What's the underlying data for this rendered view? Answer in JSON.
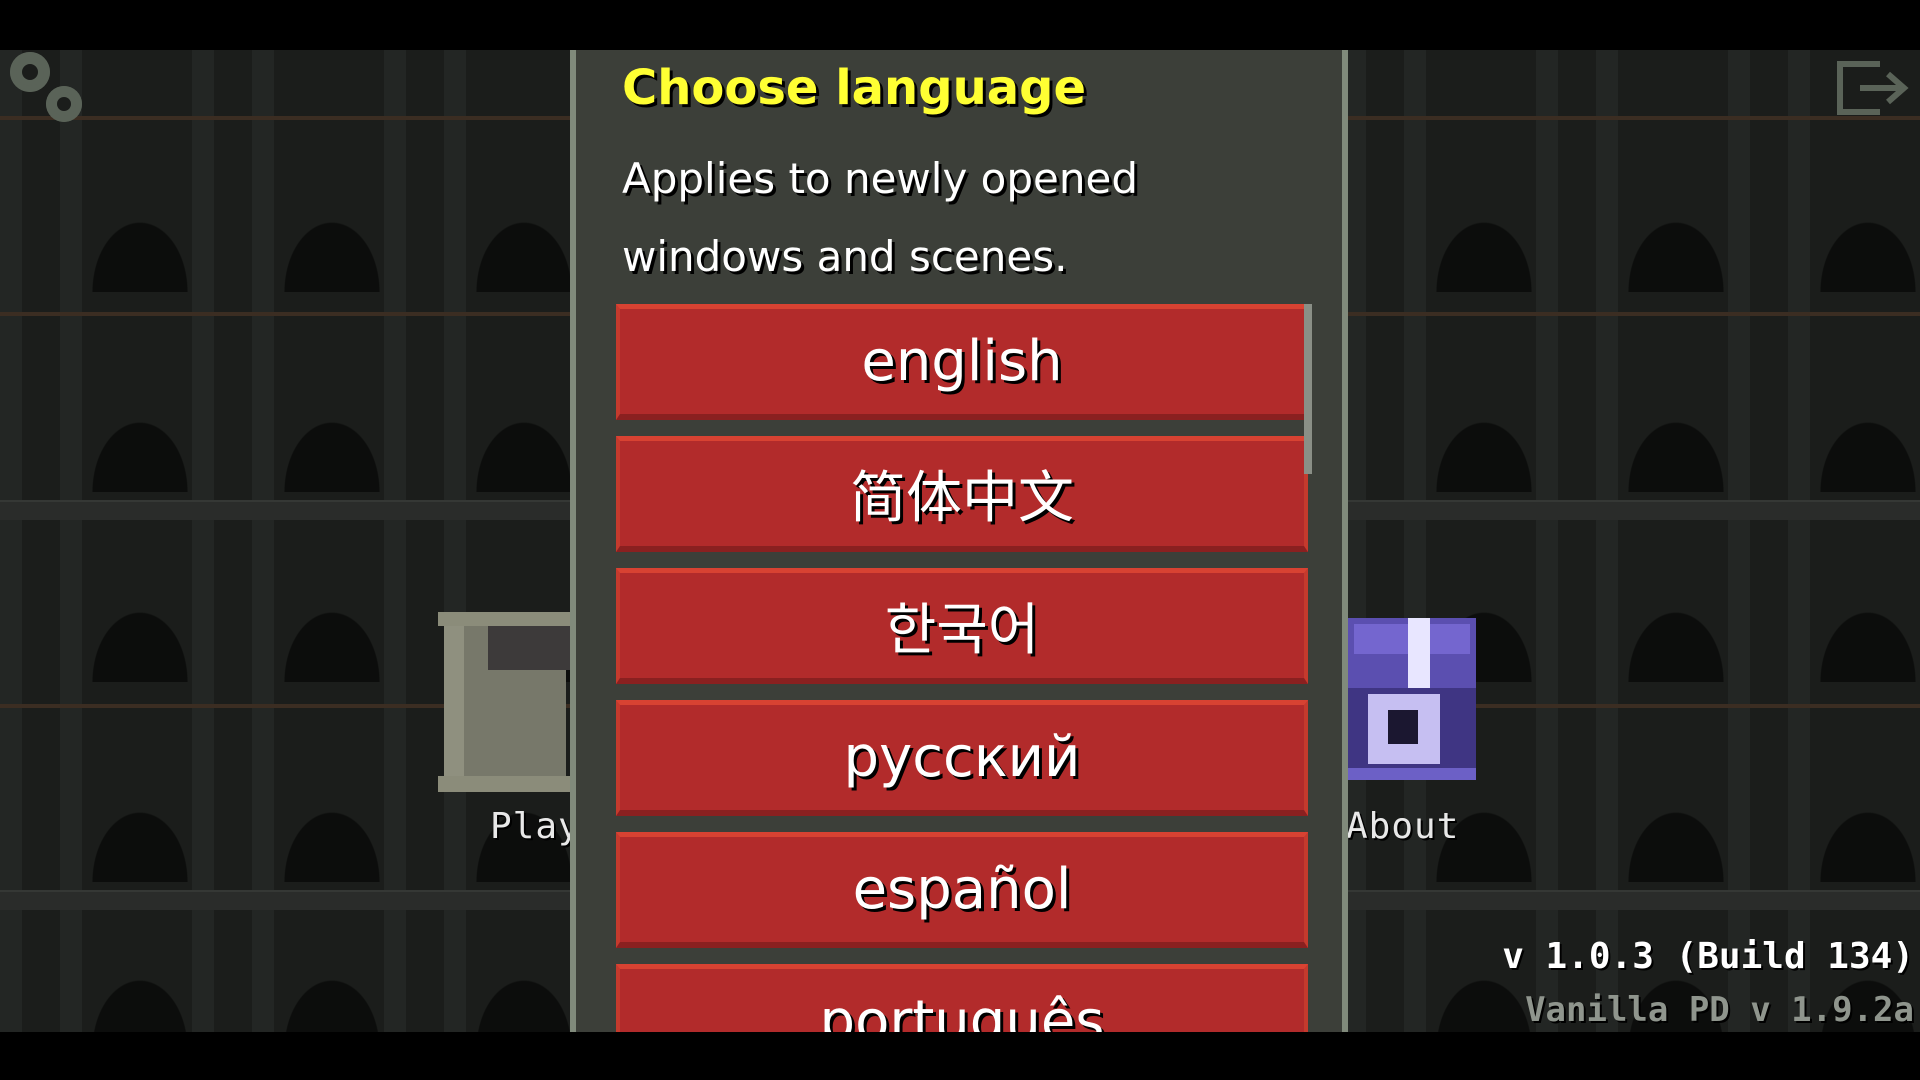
{
  "menu": {
    "play_label": "Play",
    "about_label": "About",
    "settings_icon": "gear-icon",
    "exit_icon": "exit-icon"
  },
  "version": {
    "line1": "v 1.0.3 (Build 134)",
    "line2": "Vanilla PD v 1.9.2a"
  },
  "dialog": {
    "title": "Choose language",
    "description": "Applies to newly opened windows and scenes.",
    "languages": [
      "english",
      "简体中文",
      "한국어",
      "русский",
      "español",
      "português"
    ]
  },
  "colors": {
    "title": "#ffff33",
    "button": "#b22b2b",
    "dialog_bg": "#3c3f39",
    "dialog_border": "#808a7b"
  }
}
